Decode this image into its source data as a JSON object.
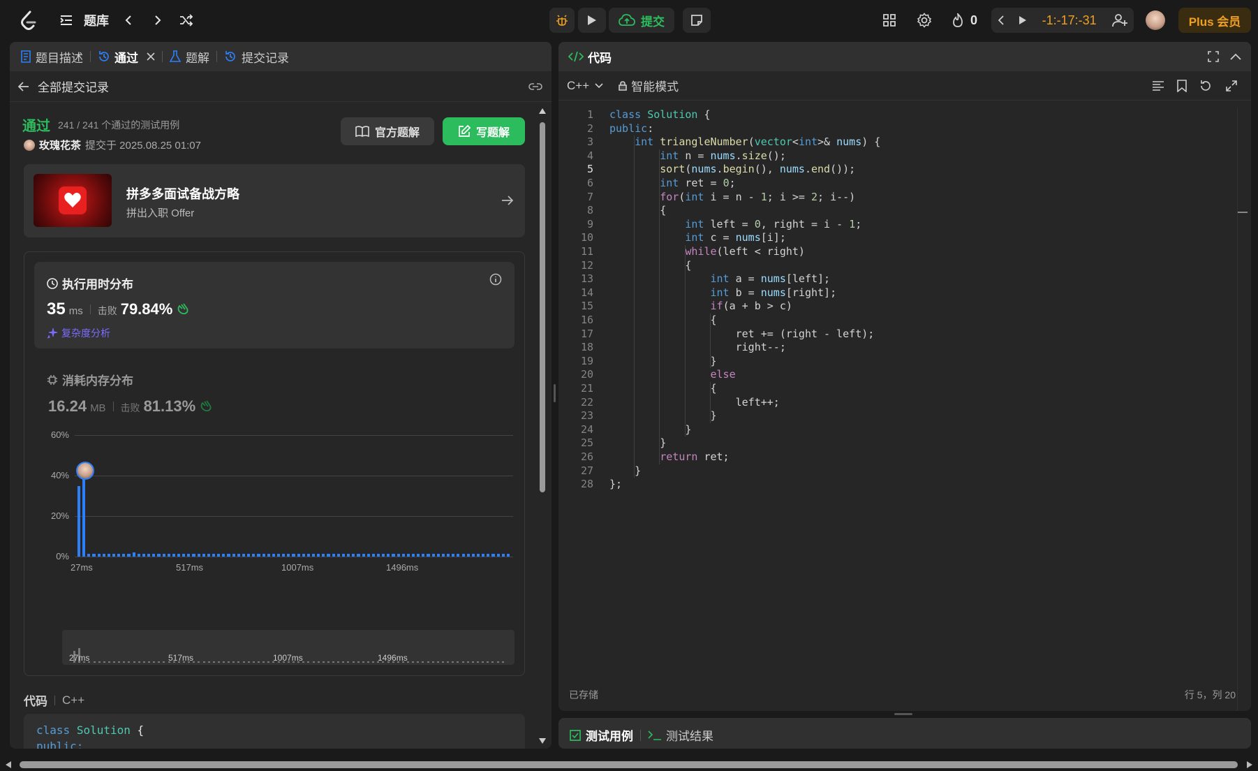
{
  "top": {
    "nav_title": "题库",
    "submit_label": "提交",
    "streak_count": "0",
    "timer": "-1:-17:-31",
    "plus_label": "Plus 会员"
  },
  "left": {
    "tabs": [
      {
        "label": "题目描述"
      },
      {
        "label": "通过"
      },
      {
        "label": "题解"
      },
      {
        "label": "提交记录"
      }
    ],
    "back_label": "全部提交记录",
    "status": "通过",
    "testcases": "241 / 241  个通过的测试用例",
    "user_name": "玫瑰花茶",
    "submitted_at": "提交于 2025.08.25 01:07",
    "official_solution_label": "官方题解",
    "write_solution_label": "写题解",
    "promo": {
      "title": "拼多多面试备战方略",
      "subtitle": "拼出入职 Offer"
    },
    "runtime": {
      "title": "执行用时分布",
      "value": "35",
      "unit": "ms",
      "beat_label": "击败",
      "beat_value": "79.84%",
      "complexity_link": "复杂度分析"
    },
    "memory": {
      "title": "消耗内存分布",
      "value": "16.24",
      "unit": "MB",
      "beat_label": "击败",
      "beat_value": "81.13%"
    },
    "code_label": "代码",
    "code_lang": "C++",
    "code_preview": [
      "class Solution {",
      "public:"
    ]
  },
  "chart_data": {
    "type": "bar",
    "title": "",
    "xlabel": "",
    "ylabel": "",
    "ylim": [
      0,
      60
    ],
    "y_ticks": [
      "60%",
      "40%",
      "20%",
      "0%"
    ],
    "x_ticks": [
      "27ms",
      "517ms",
      "1007ms",
      "1496ms"
    ],
    "highlight_bin": 1,
    "values": [
      35,
      42,
      1.5,
      1.5,
      1.5,
      1.5,
      1.5,
      1.5,
      1.5,
      1.5,
      1.5,
      2,
      1.5,
      1.5,
      1.5,
      1.5,
      1.5,
      1.5,
      1.5,
      1.5,
      1.5,
      1.5,
      1.5,
      1.5,
      1.5,
      1.5,
      1.5,
      1.5,
      1.5,
      1.5,
      1.5,
      1.5,
      1.5,
      1.5,
      1.5,
      1.5,
      1.5,
      1.5,
      1.5,
      1.5,
      1.5,
      1.5,
      1.5,
      1.5,
      1.5,
      1.5,
      1.5,
      1.5,
      1.5,
      1.5,
      1.5,
      1.5,
      1.5,
      1.5,
      1.5,
      1.5,
      1.5,
      1.5,
      1.5,
      1.5,
      1.5,
      1.5,
      1.5,
      1.5,
      1.5,
      1.5,
      1.5,
      1.5,
      1.5,
      1.5,
      1.5,
      1.5,
      1.5,
      1.5,
      1.5,
      1.5,
      1.5,
      1.5,
      1.5,
      1.5,
      1.5,
      1.5,
      1.5,
      1.5,
      1.5,
      1.5,
      1.5
    ]
  },
  "editor": {
    "title": "代码",
    "language": "C++",
    "mode_label": "智能模式",
    "saved_label": "已存储",
    "cursor_pos": "行 5，列 20",
    "lines": [
      "class Solution {",
      "public:",
      "    int triangleNumber(vector<int>& nums) {",
      "        int n = nums.size();",
      "        sort(nums.begin(), nums.end());",
      "        int ret = 0;",
      "        for(int i = n - 1; i >= 2; i--)",
      "        {",
      "            int left = 0, right = i - 1;",
      "            int c = nums[i];",
      "            while(left < right)",
      "            {",
      "                int a = nums[left];",
      "                int b = nums[right];",
      "                if(a + b > c)",
      "                {",
      "                    ret += (right - left);",
      "                    right--;",
      "                }",
      "                else",
      "                {",
      "                    left++;",
      "                }",
      "            }",
      "        }",
      "        return ret;",
      "    }",
      "};"
    ]
  },
  "bottom": {
    "tab_testcase": "测试用例",
    "tab_result": "测试结果"
  },
  "colors": {
    "accent_green": "#2cbb5d",
    "accent_blue": "#2d7ff9",
    "plus_gold": "#f0a020"
  }
}
